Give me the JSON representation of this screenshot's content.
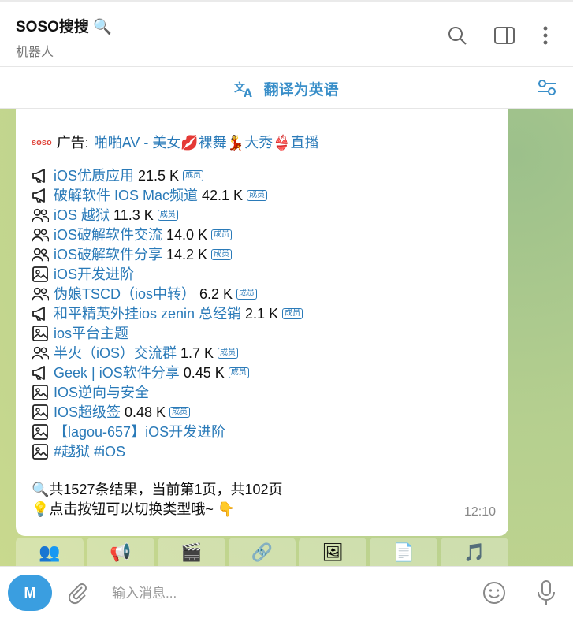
{
  "header": {
    "title": "SOSO搜搜 🔍",
    "subtitle": "机器人"
  },
  "translate": {
    "label": "翻译为英语"
  },
  "message": {
    "ad": {
      "logo": "soso",
      "prefix": "广告:",
      "text": "啪啪AV - 美女💋裸舞💃大秀👙直播"
    },
    "items": [
      {
        "icon": "megaphone",
        "name": "iOS优质应用",
        "count": "21.5 K",
        "badge": "成员"
      },
      {
        "icon": "megaphone",
        "name": "破解软件 IOS Mac频道",
        "count": "42.1 K",
        "badge": "成员"
      },
      {
        "icon": "group",
        "name": "iOS 越狱",
        "count": "11.3 K",
        "badge": "成员"
      },
      {
        "icon": "group",
        "name": "iOS破解软件交流",
        "count": "14.0 K",
        "badge": "成员"
      },
      {
        "icon": "group",
        "name": "iOS破解软件分享",
        "count": "14.2 K",
        "badge": "成员"
      },
      {
        "icon": "image",
        "name": "iOS开发进阶",
        "count": "",
        "badge": ""
      },
      {
        "icon": "group",
        "name": "伪娘TSCD（ios中转）",
        "count": "6.2 K",
        "badge": "成员"
      },
      {
        "icon": "megaphone",
        "name": "和平精英外挂ios zenin 总经销",
        "count": "2.1 K",
        "badge": "成员"
      },
      {
        "icon": "image",
        "name": "ios平台主题",
        "count": "",
        "badge": ""
      },
      {
        "icon": "group",
        "name": "半火（iOS）交流群",
        "count": "1.7 K",
        "badge": "成员"
      },
      {
        "icon": "megaphone",
        "name": "Geek | iOS软件分享",
        "count": "0.45 K",
        "badge": "成员"
      },
      {
        "icon": "image",
        "name": "IOS逆向与安全",
        "count": "",
        "badge": ""
      },
      {
        "icon": "image",
        "name": "IOS超级签",
        "count": "0.48 K",
        "badge": "成员"
      },
      {
        "icon": "image",
        "name": "【lagou-657】iOS开发进阶",
        "count": "",
        "badge": ""
      },
      {
        "icon": "image",
        "name": "#越狱 #iOS",
        "count": "",
        "badge": ""
      }
    ],
    "summary": "🔍共1527条结果，当前第1页，共102页",
    "hint": "💡点击按钮可以切换类型哦~ 👇",
    "time": "12:10"
  },
  "keyboard": [
    {
      "icon": "group-icon",
      "glyph": "👥"
    },
    {
      "icon": "megaphone-icon",
      "glyph": "📢"
    },
    {
      "icon": "video-icon",
      "glyph": "🎬"
    },
    {
      "icon": "link-icon",
      "glyph": "🔗"
    },
    {
      "icon": "picture-icon",
      "glyph": "🖼"
    },
    {
      "icon": "file-icon",
      "glyph": "📄"
    },
    {
      "icon": "music-icon",
      "glyph": "🎵"
    }
  ],
  "input": {
    "avatar_letter": "M",
    "placeholder": "输入消息..."
  },
  "colors": {
    "link": "#2a7ab8",
    "accent": "#3a8fc9",
    "avatar": "#3a9ee0"
  }
}
